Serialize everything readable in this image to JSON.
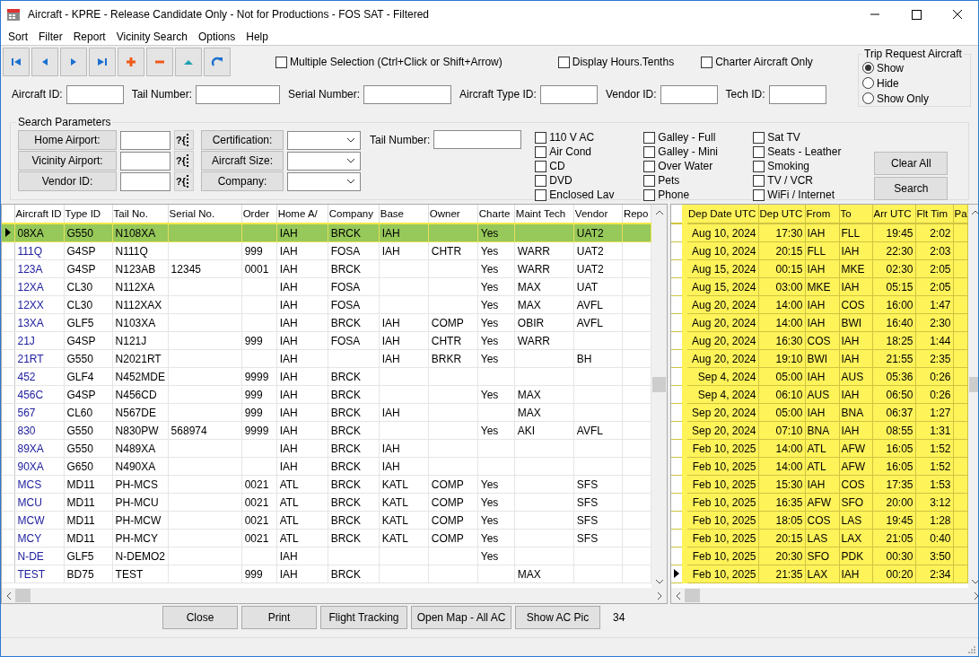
{
  "window": {
    "title": "Aircraft - KPRE - Release Candidate Only - Not for Productions - FOS SAT - Filtered"
  },
  "menu": [
    "Sort",
    "Filter",
    "Report",
    "Vicinity Search",
    "Options",
    "Help"
  ],
  "nav_buttons": [
    {
      "kind": "first"
    },
    {
      "kind": "prev"
    },
    {
      "kind": "next"
    },
    {
      "kind": "last"
    },
    {
      "kind": "add"
    },
    {
      "kind": "delete"
    },
    {
      "kind": "up"
    },
    {
      "kind": "refresh"
    }
  ],
  "options": [
    {
      "label": "Multiple Selection (Ctrl+Click or Shift+Arrow)",
      "checked": false
    },
    {
      "label": "Display Hours.Tenths",
      "checked": false
    },
    {
      "label": "Charter Aircraft Only",
      "checked": false
    }
  ],
  "trip_request": {
    "title": "Trip Request Aircraft",
    "options": [
      {
        "label": "Show",
        "selected": true
      },
      {
        "label": "Hide",
        "selected": false
      },
      {
        "label": "Show Only",
        "selected": false
      }
    ]
  },
  "filters": [
    {
      "label": "Aircraft ID:"
    },
    {
      "label": "Tail Number:"
    },
    {
      "label": "Serial Number:"
    },
    {
      "label": "Aircraft Type ID:"
    },
    {
      "label": "Vendor ID:"
    },
    {
      "label": "Tech ID:"
    }
  ],
  "search_parameters": {
    "title": "Search Parameters",
    "lookups": [
      {
        "label": "Home Airport:",
        "lookup": "?{"
      },
      {
        "label": "Vicinity Airport:",
        "lookup": "?{"
      },
      {
        "label": "Vendor ID:",
        "lookup": "?{"
      }
    ],
    "dropdowns": [
      {
        "label": "Certification:"
      },
      {
        "label": "Aircraft Size:"
      },
      {
        "label": "Company:"
      }
    ],
    "tail_number": {
      "label": "Tail Number:"
    },
    "amenities": [
      {
        "label": "110 V AC",
        "checked": false
      },
      {
        "label": "Air Cond",
        "checked": false
      },
      {
        "label": "CD",
        "checked": false
      },
      {
        "label": "DVD",
        "checked": false
      },
      {
        "label": "Enclosed Lav",
        "checked": false
      },
      {
        "label": "Galley - Full",
        "checked": false
      },
      {
        "label": "Galley - Mini",
        "checked": false
      },
      {
        "label": "Over Water",
        "checked": false
      },
      {
        "label": "Pets",
        "checked": false
      },
      {
        "label": "Phone",
        "checked": false
      },
      {
        "label": "Sat TV",
        "checked": false
      },
      {
        "label": "Seats - Leather",
        "checked": false
      },
      {
        "label": "Smoking",
        "checked": false
      },
      {
        "label": "TV / VCR",
        "checked": false
      },
      {
        "label": "WiFi / Internet",
        "checked": false
      }
    ],
    "buttons": [
      "Clear All",
      "Search"
    ]
  },
  "aircraft_grid": {
    "columns": [
      "Aircraft ID",
      "Type ID",
      "Tail No.",
      "Serial No.",
      "Order",
      "Home A/",
      "Company",
      "Base",
      "Owner",
      "Charte",
      "Maint Tech",
      "Vendor",
      "Repo"
    ],
    "rows": [
      {
        "selected": true,
        "cells": [
          "08XA",
          "G550",
          "N108XA",
          "",
          "",
          "IAH",
          "BRCK",
          "IAH",
          "",
          "Yes",
          "",
          "UAT2",
          ""
        ]
      },
      {
        "selected": false,
        "cells": [
          "111Q",
          "G4SP",
          "N111Q",
          "",
          "999",
          "IAH",
          "FOSA",
          "IAH",
          "CHTR",
          "Yes",
          "WARR",
          "UAT2",
          ""
        ]
      },
      {
        "selected": false,
        "cells": [
          "123A",
          "G4SP",
          "N123AB",
          "12345",
          "0001",
          "IAH",
          "BRCK",
          "",
          "",
          "Yes",
          "WARR",
          "UAT2",
          ""
        ]
      },
      {
        "selected": false,
        "cells": [
          "12XA",
          "CL30",
          "N112XA",
          "",
          "",
          "IAH",
          "FOSA",
          "",
          "",
          "Yes",
          "MAX",
          "UAT",
          ""
        ]
      },
      {
        "selected": false,
        "cells": [
          "12XX",
          "CL30",
          "N112XAX",
          "",
          "",
          "IAH",
          "FOSA",
          "",
          "",
          "Yes",
          "MAX",
          "AVFL",
          ""
        ]
      },
      {
        "selected": false,
        "cells": [
          "13XA",
          "GLF5",
          "N103XA",
          "",
          "",
          "IAH",
          "BRCK",
          "IAH",
          "COMP",
          "Yes",
          "OBIR",
          "AVFL",
          ""
        ]
      },
      {
        "selected": false,
        "cells": [
          "21J",
          "G4SP",
          "N121J",
          "",
          "999",
          "IAH",
          "FOSA",
          "IAH",
          "CHTR",
          "Yes",
          "WARR",
          "",
          ""
        ]
      },
      {
        "selected": false,
        "cells": [
          "21RT",
          "G550",
          "N2021RT",
          "",
          "",
          "IAH",
          "",
          "IAH",
          "BRKR",
          "Yes",
          "",
          "BH",
          ""
        ]
      },
      {
        "selected": false,
        "cells": [
          "452",
          "GLF4",
          "N452MDE",
          "",
          "9999",
          "IAH",
          "BRCK",
          "",
          "",
          "",
          "",
          "",
          ""
        ]
      },
      {
        "selected": false,
        "cells": [
          "456C",
          "G4SP",
          "N456CD",
          "",
          "999",
          "IAH",
          "BRCK",
          "",
          "",
          "Yes",
          "MAX",
          "",
          ""
        ]
      },
      {
        "selected": false,
        "cells": [
          "567",
          "CL60",
          "N567DE",
          "",
          "999",
          "IAH",
          "BRCK",
          "IAH",
          "",
          "",
          "MAX",
          "",
          ""
        ]
      },
      {
        "selected": false,
        "cells": [
          "830",
          "G550",
          "N830PW",
          "568974",
          "9999",
          "IAH",
          "BRCK",
          "",
          "",
          "Yes",
          "AKI",
          "AVFL",
          ""
        ]
      },
      {
        "selected": false,
        "cells": [
          "89XA",
          "G550",
          "N489XA",
          "",
          "",
          "IAH",
          "BRCK",
          "IAH",
          "",
          "",
          "",
          "",
          ""
        ]
      },
      {
        "selected": false,
        "cells": [
          "90XA",
          "G650",
          "N490XA",
          "",
          "",
          "IAH",
          "BRCK",
          "IAH",
          "",
          "",
          "",
          "",
          ""
        ]
      },
      {
        "selected": false,
        "cells": [
          "MCS",
          "MD11",
          "PH-MCS",
          "",
          "0021",
          "ATL",
          "BRCK",
          "KATL",
          "COMP",
          "Yes",
          "",
          "SFS",
          ""
        ]
      },
      {
        "selected": false,
        "cells": [
          "MCU",
          "MD11",
          "PH-MCU",
          "",
          "0021",
          "ATL",
          "BRCK",
          "KATL",
          "COMP",
          "Yes",
          "",
          "SFS",
          ""
        ]
      },
      {
        "selected": false,
        "cells": [
          "MCW",
          "MD11",
          "PH-MCW",
          "",
          "0021",
          "ATL",
          "BRCK",
          "KATL",
          "COMP",
          "Yes",
          "",
          "SFS",
          ""
        ]
      },
      {
        "selected": false,
        "cells": [
          "MCY",
          "MD11",
          "PH-MCY",
          "",
          "0021",
          "ATL",
          "BRCK",
          "KATL",
          "COMP",
          "Yes",
          "",
          "SFS",
          ""
        ]
      },
      {
        "selected": false,
        "cells": [
          "N-DE",
          "GLF5",
          "N-DEMO2",
          "",
          "",
          "IAH",
          "",
          "",
          "",
          "Yes",
          "",
          "",
          ""
        ]
      },
      {
        "selected": false,
        "cells": [
          "TEST",
          "BD75",
          "TEST",
          "",
          "999",
          "IAH",
          "BRCK",
          "",
          "",
          "",
          "MAX",
          "",
          ""
        ]
      }
    ]
  },
  "trips_grid": {
    "columns": [
      "Dep Date UTC",
      "Dep UTC",
      "From",
      "To",
      "Arr UTC",
      "Flt Tim",
      "Pa"
    ],
    "rows": [
      {
        "current": false,
        "cells": [
          "Aug 10, 2024",
          "17:30",
          "IAH",
          "FLL",
          "19:45",
          "2:02",
          ""
        ]
      },
      {
        "current": false,
        "cells": [
          "Aug 10, 2024",
          "20:15",
          "FLL",
          "IAH",
          "22:30",
          "2:03",
          ""
        ]
      },
      {
        "current": false,
        "cells": [
          "Aug 15, 2024",
          "00:15",
          "IAH",
          "MKE",
          "02:30",
          "2:05",
          ""
        ]
      },
      {
        "current": false,
        "cells": [
          "Aug 15, 2024",
          "03:00",
          "MKE",
          "IAH",
          "05:15",
          "2:05",
          ""
        ]
      },
      {
        "current": false,
        "cells": [
          "Aug 20, 2024",
          "14:00",
          "IAH",
          "COS",
          "16:00",
          "1:47",
          ""
        ]
      },
      {
        "current": false,
        "cells": [
          "Aug 20, 2024",
          "14:00",
          "IAH",
          "BWI",
          "16:40",
          "2:30",
          ""
        ]
      },
      {
        "current": false,
        "cells": [
          "Aug 20, 2024",
          "16:30",
          "COS",
          "IAH",
          "18:25",
          "1:44",
          ""
        ]
      },
      {
        "current": false,
        "cells": [
          "Aug 20, 2024",
          "19:10",
          "BWI",
          "IAH",
          "21:55",
          "2:35",
          ""
        ]
      },
      {
        "current": false,
        "cells": [
          "Sep 4, 2024",
          "05:00",
          "IAH",
          "AUS",
          "05:36",
          "0:26",
          ""
        ]
      },
      {
        "current": false,
        "cells": [
          "Sep 4, 2024",
          "06:10",
          "AUS",
          "IAH",
          "06:50",
          "0:26",
          ""
        ]
      },
      {
        "current": false,
        "cells": [
          "Sep 20, 2024",
          "05:00",
          "IAH",
          "BNA",
          "06:37",
          "1:27",
          ""
        ]
      },
      {
        "current": false,
        "cells": [
          "Sep 20, 2024",
          "07:10",
          "BNA",
          "IAH",
          "08:55",
          "1:31",
          ""
        ]
      },
      {
        "current": false,
        "cells": [
          "Feb 10, 2025",
          "14:00",
          "ATL",
          "AFW",
          "16:05",
          "1:52",
          ""
        ]
      },
      {
        "current": false,
        "cells": [
          "Feb 10, 2025",
          "14:00",
          "ATL",
          "AFW",
          "16:05",
          "1:52",
          ""
        ]
      },
      {
        "current": false,
        "cells": [
          "Feb 10, 2025",
          "15:30",
          "IAH",
          "COS",
          "17:35",
          "1:53",
          ""
        ]
      },
      {
        "current": false,
        "cells": [
          "Feb 10, 2025",
          "16:35",
          "AFW",
          "SFO",
          "20:00",
          "3:12",
          ""
        ]
      },
      {
        "current": false,
        "cells": [
          "Feb 10, 2025",
          "18:05",
          "COS",
          "LAS",
          "19:45",
          "1:28",
          ""
        ]
      },
      {
        "current": false,
        "cells": [
          "Feb 10, 2025",
          "20:15",
          "LAS",
          "LAX",
          "21:05",
          "0:40",
          ""
        ]
      },
      {
        "current": false,
        "cells": [
          "Feb 10, 2025",
          "20:30",
          "SFO",
          "PDK",
          "00:30",
          "3:50",
          ""
        ]
      },
      {
        "current": true,
        "cells": [
          "Feb 10, 2025",
          "21:35",
          "LAX",
          "IAH",
          "00:20",
          "2:34",
          ""
        ]
      }
    ]
  },
  "footer": {
    "buttons": [
      "Close",
      "Print",
      "Flight Tracking",
      "Open Map - All AC",
      "Show AC Pic"
    ],
    "count": "34"
  }
}
